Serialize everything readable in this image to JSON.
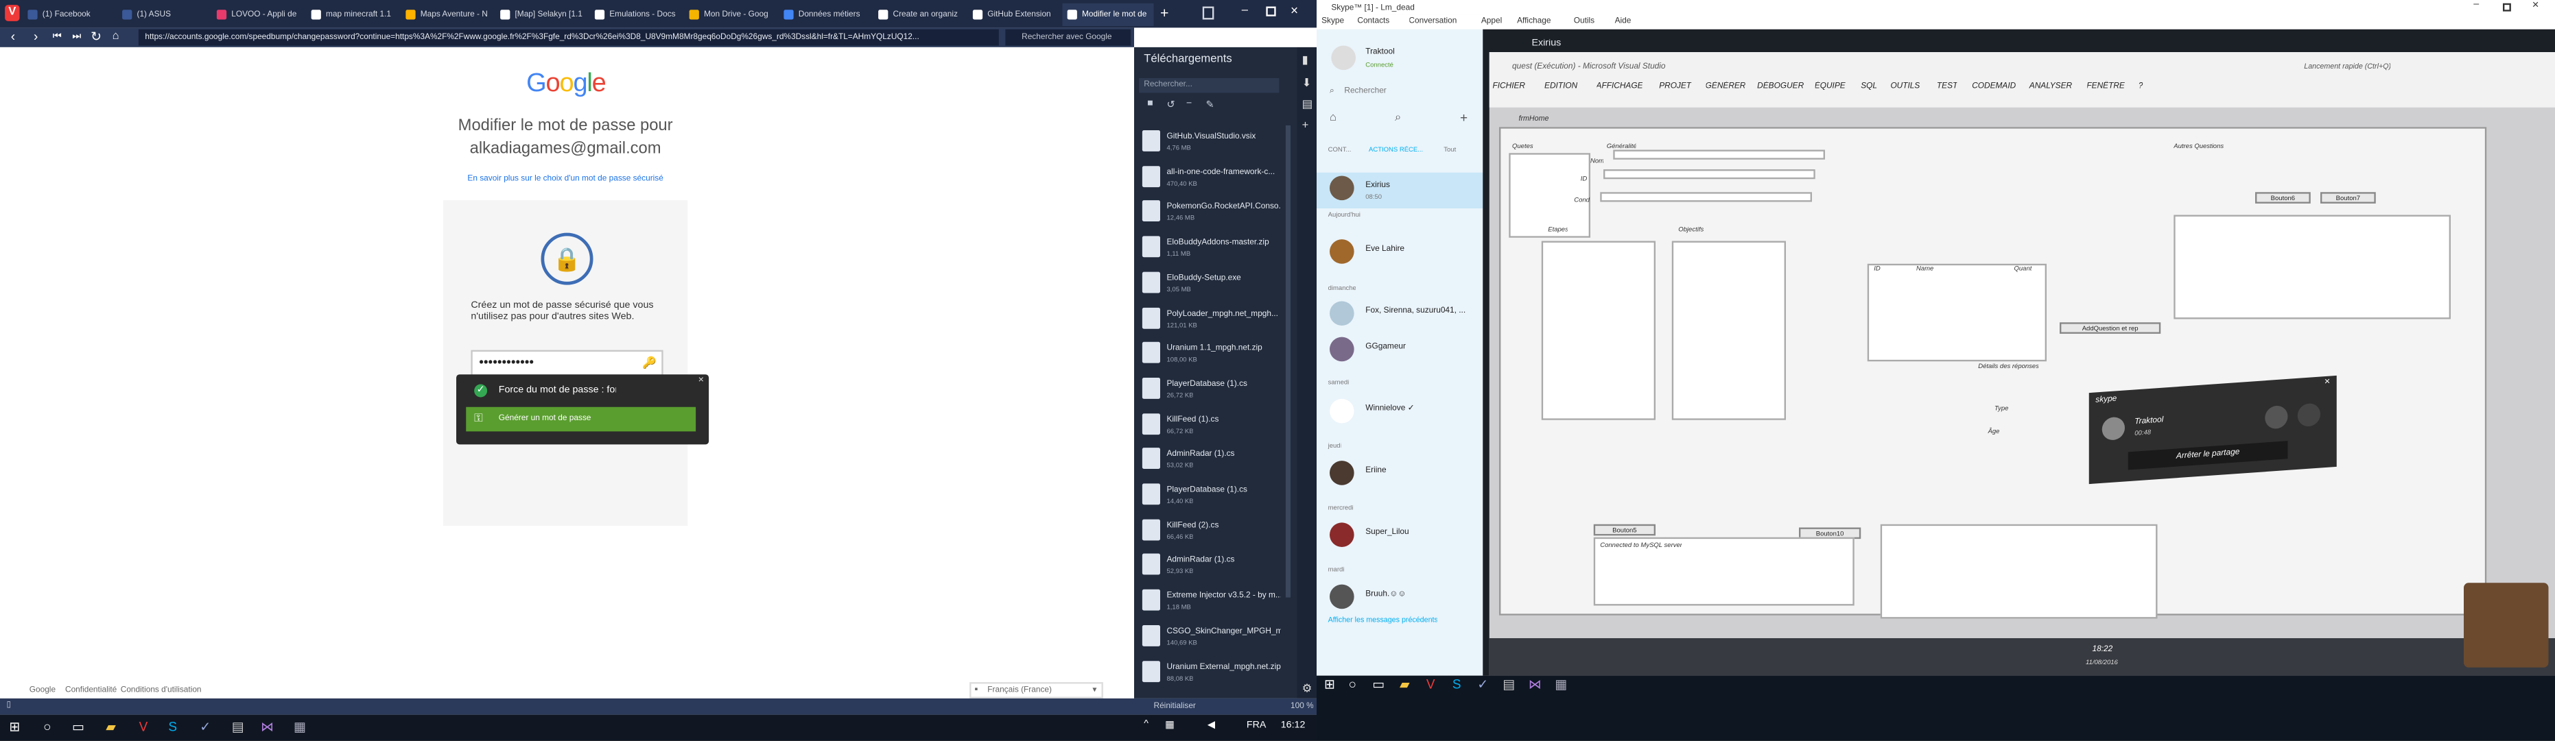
{
  "browser": {
    "tabs": [
      {
        "label": "(1) Facebook",
        "color": "#3b5998"
      },
      {
        "label": "(1) ASUS",
        "color": "#3b5998"
      },
      {
        "label": "LOVOO - Appli de",
        "color": "#e83a6b"
      },
      {
        "label": "map minecraft 1.1",
        "color": "#ffffff"
      },
      {
        "label": "Maps Aventure - N",
        "color": "#ffb400"
      },
      {
        "label": "[Map] Selakyn [1.1",
        "color": "#ffffff"
      },
      {
        "label": "Emulations - Docs",
        "color": "#ffffff"
      },
      {
        "label": "Mon Drive - Goog",
        "color": "#f4b400"
      },
      {
        "label": "Données métiers",
        "color": "#4285f4"
      },
      {
        "label": "Create an organiz",
        "color": "#ffffff"
      },
      {
        "label": "GitHub Extension",
        "color": "#ffffff"
      },
      {
        "label": "Modifier le mot de",
        "color": "#ffffff"
      }
    ],
    "url": "https://accounts.google.com/speedbump/changepassword?continue=https%3A%2F%2Fwww.google.fr%2F%3Fgfe_rd%3Dcr%26ei%3D8_U8V9mM8Mr8geq6oDoDg%26gws_rd%3Dssl&hl=fr&TL=AHmYQLzUQ12...",
    "search_placeholder": "Rechercher avec Google",
    "status_left": "Réinitialiser",
    "zoom": "100 %"
  },
  "google": {
    "logo": "Google",
    "title": "Modifier le mot de passe pour alkadiagames@gmail.com",
    "learn_more": "En savoir plus sur le choix d'un mot de passe sécurisé",
    "description": "Créez un mot de passe sécurisé que vous n'utilisez pas pour d'autres sites Web.",
    "password1": "••••••••••••",
    "password2": "••••••••••••",
    "strength": "Force du mot de passe : fort",
    "generate": "Générer un mot de passe",
    "footer": [
      "Google",
      "Confidentialité",
      "Conditions d'utilisation"
    ],
    "language": "Français (France)"
  },
  "downloads": {
    "title": "Téléchargements",
    "search_placeholder": "Rechercher...",
    "items": [
      {
        "name": "GitHub.VisualStudio.vsix",
        "size": "4,76 MB"
      },
      {
        "name": "all-in-one-code-framework-c...",
        "size": "470,40 KB"
      },
      {
        "name": "PokemonGo.RocketAPI.Conso...",
        "size": "12,46 MB"
      },
      {
        "name": "EloBuddyAddons-master.zip",
        "size": "1,11 MB"
      },
      {
        "name": "EloBuddy-Setup.exe",
        "size": "3,05 MB"
      },
      {
        "name": "PolyLoader_mpgh.net_mpgh...",
        "size": "121,01 KB"
      },
      {
        "name": "Uranium 1.1_mpgh.net.zip",
        "size": "108,00 KB"
      },
      {
        "name": "PlayerDatabase (1).cs",
        "size": "26,72 KB"
      },
      {
        "name": "KillFeed (1).cs",
        "size": "66,72 KB"
      },
      {
        "name": "AdminRadar (1).cs",
        "size": "53,02 KB"
      },
      {
        "name": "PlayerDatabase (1).cs",
        "size": "14,40 KB"
      },
      {
        "name": "KillFeed (2).cs",
        "size": "66,46 KB"
      },
      {
        "name": "AdminRadar (1).cs",
        "size": "52,93 KB"
      },
      {
        "name": "Extreme Injector v3.5.2 - by m...",
        "size": "1,18 MB"
      },
      {
        "name": "CSGO_SkinChanger_MPGH_m...",
        "size": "140,69 KB"
      },
      {
        "name": "Uranium External_mpgh.net.zip",
        "size": "88,08 KB"
      }
    ]
  },
  "skype": {
    "window_title": "Skype™ [1] - Lm_dead",
    "menu": [
      "Skype",
      "Contacts",
      "Conversation",
      "Appel",
      "Affichage",
      "Outils",
      "Aide"
    ],
    "profile_name": "Traktool",
    "profile_status": "Connecté",
    "search": "Rechercher",
    "tabs": [
      "CONT...",
      "ACTIONS RÉCE...",
      "Tout"
    ],
    "contacts": [
      {
        "section": "",
        "name": "Exirius",
        "time": "08:50"
      },
      {
        "section": "Aujourd'hui",
        "name": "Eve Lahire",
        "time": ""
      },
      {
        "section": "dimanche",
        "name": "Fox, Sirenna, suzuru041, ...",
        "time": ""
      },
      {
        "section": "",
        "name": "GGgameur",
        "time": ""
      },
      {
        "section": "samedi",
        "name": "Winnielove ✓",
        "time": ""
      },
      {
        "section": "jeudi",
        "name": "Eriine",
        "time": ""
      },
      {
        "section": "mercredi",
        "name": "Super_Lilou",
        "time": ""
      },
      {
        "section": "mardi",
        "name": "Bruuh.☺☺",
        "time": ""
      }
    ],
    "show_previous": "Afficher les messages précédents",
    "conversation_title": "Exirius"
  },
  "screen_share": {
    "vs_title": "quest (Exécution) - Microsoft Visual Studio",
    "vs_search": "Lancement rapide (Ctrl+Q)",
    "vs_menu": [
      "FICHIER",
      "EDITION",
      "AFFICHAGE",
      "PROJET",
      "GÉNÉRER",
      "DÉBOGUER",
      "ÉQUIPE",
      "SQL",
      "OUTILS",
      "TEST",
      "CODEMAID",
      "ANALYSER",
      "FENÊTRE",
      "?"
    ],
    "form_tab": "frmHome",
    "labels": [
      "Quetes",
      "Généralité",
      "Nom",
      "ID",
      "Cond",
      "Etapes",
      "Objectifs",
      "Autres Questions",
      "Détails des réponses",
      "Type",
      "Âge",
      "Connected to MySQL server",
      "Bouton6",
      "Bouton7",
      "Bouton5",
      "Bouton10",
      "AddQuestion et rep"
    ],
    "col_headers": [
      "ID",
      "Name",
      "Quant"
    ],
    "call_name": "Traktool",
    "call_time": "00:48",
    "share_stop": "Arrêter le partage",
    "clock_time": "18:22",
    "clock_date": "11/08/2016"
  },
  "taskbar": {
    "lang": "FRA",
    "time": "16:12"
  }
}
